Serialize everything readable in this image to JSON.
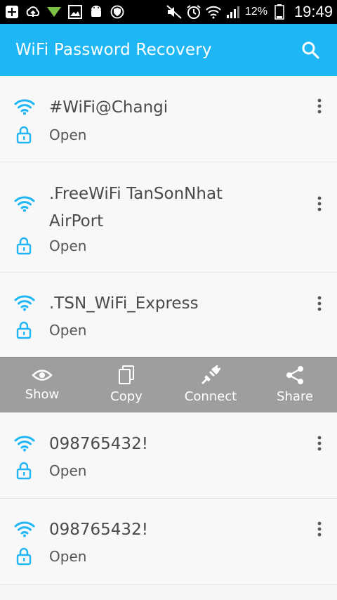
{
  "status_bar": {
    "battery_text": "12%",
    "time": "19:49",
    "icons": [
      "plus-box-icon",
      "cloud-upload-icon",
      "download-arrow-icon",
      "image-icon",
      "android-icon",
      "shield-icon",
      "mute-icon",
      "alarm-icon",
      "wifi-icon",
      "signal-icon",
      "battery-icon"
    ]
  },
  "app_bar": {
    "title": "WiFi Password Recovery",
    "color": "#1fb6f5",
    "search_icon": "search-icon"
  },
  "networks": [
    {
      "name": "#WiFi@Changi",
      "status": "Open"
    },
    {
      "name": ".FreeWiFi TanSonNhat AirPort",
      "status": "Open"
    },
    {
      "name": ".TSN_WiFi_Express",
      "status": "Open"
    },
    {
      "name": "098765432!",
      "status": "Open"
    },
    {
      "name": "098765432!",
      "status": "Open"
    }
  ],
  "action_bar": {
    "actions": [
      {
        "label": "Show",
        "icon": "eye-icon"
      },
      {
        "label": "Copy",
        "icon": "copy-icon"
      },
      {
        "label": "Connect",
        "icon": "plug-icon"
      },
      {
        "label": "Share",
        "icon": "share-icon"
      }
    ]
  }
}
